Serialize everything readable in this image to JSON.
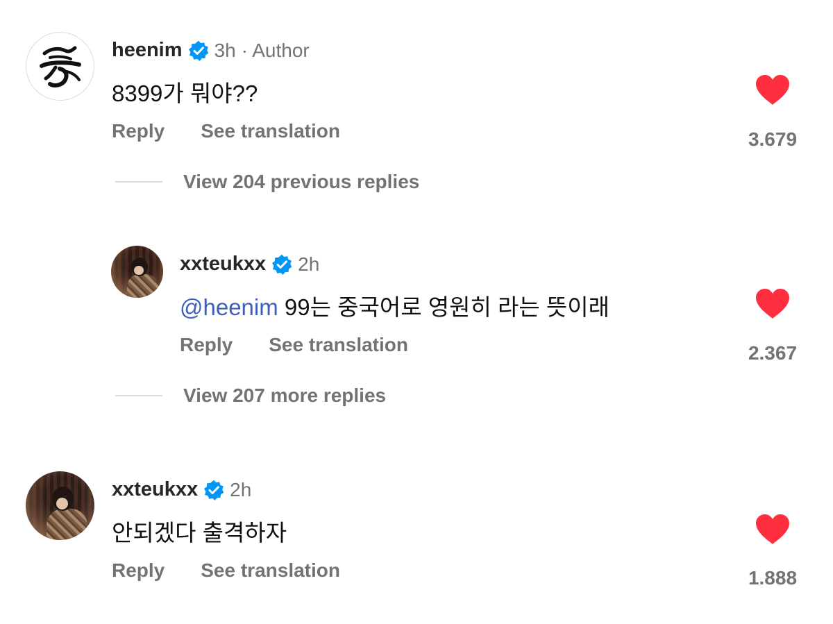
{
  "comments": [
    {
      "username": "heenim",
      "time": "3h",
      "author_tag": "· Author",
      "avatar": "logo-avatar",
      "text": "8399가 뭐야??",
      "reply_label": "Reply",
      "translate_label": "See translation",
      "likes": "3.679"
    },
    {
      "username": "xxteukxx",
      "time": "2h",
      "avatar": "photo-avatar",
      "mention": "@heenim",
      "text": "99는 중국어로 영원히 라는 뜻이래",
      "reply_label": "Reply",
      "translate_label": "See translation",
      "likes": "2.367"
    },
    {
      "username": "xxteukxx",
      "time": "2h",
      "avatar": "photo-avatar",
      "text": "안되겠다 출격하자",
      "reply_label": "Reply",
      "translate_label": "See translation",
      "likes": "1.888"
    }
  ],
  "view_previous": "View 204 previous replies",
  "view_more": "View 207 more replies",
  "colors": {
    "heart": "#ff2f40",
    "verified": "#0095f6",
    "secondary_text": "#737373",
    "mention": "#3f5fbf"
  },
  "icons": {
    "verified": "verified-badge-icon",
    "like": "heart-icon",
    "logo_glyph": "嵩"
  }
}
